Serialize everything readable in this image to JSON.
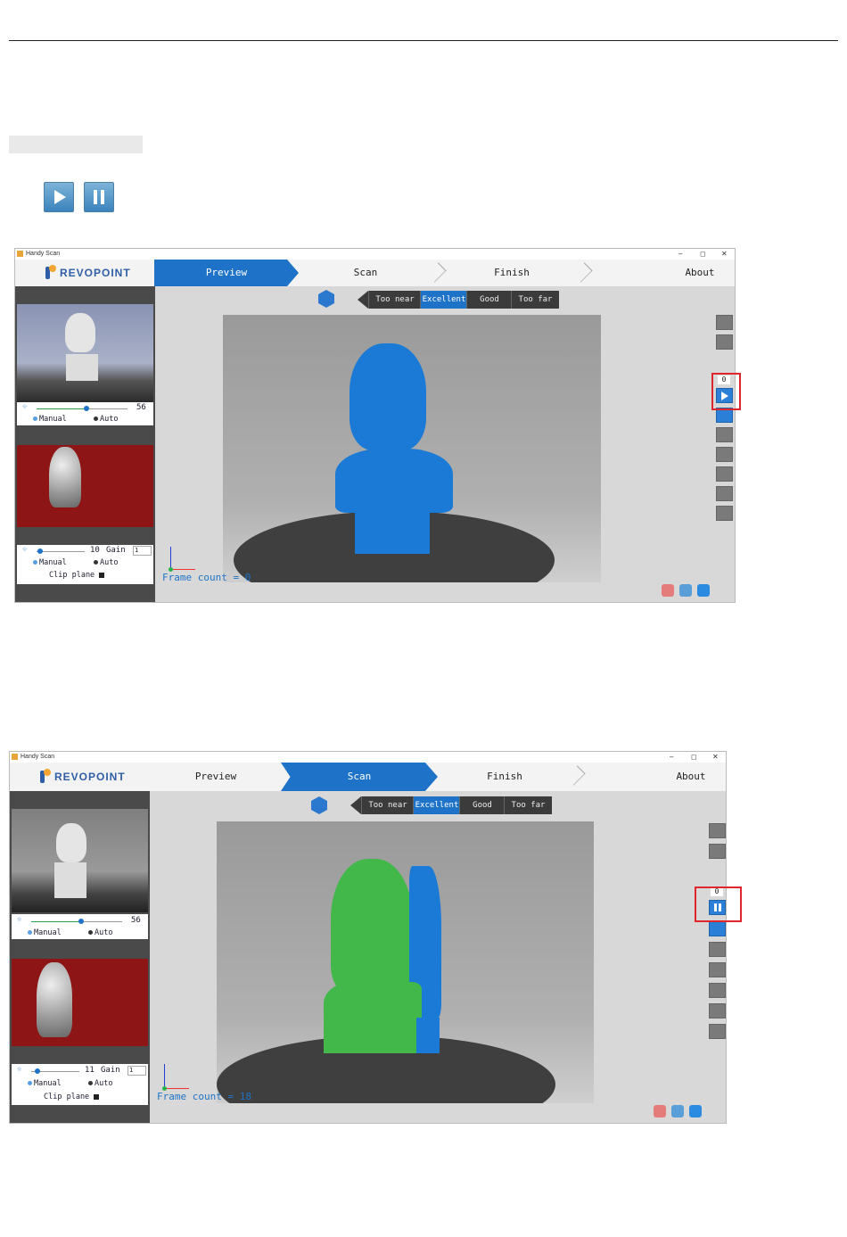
{
  "icons": {
    "play": "play-icon",
    "pause": "pause-icon"
  },
  "window1": {
    "title": "Handy Scan",
    "controls": [
      "–",
      "◻",
      "✕"
    ],
    "brand": "REVOPOINT",
    "tabs": [
      "Preview",
      "Scan",
      "Finish",
      "About"
    ],
    "active_tab": "Preview",
    "distance": [
      "Too near",
      "Excellent",
      "Good",
      "Too far"
    ],
    "distance_selected": "Excellent",
    "ir_value": "56",
    "ir_mode": {
      "manual": "Manual",
      "auto": "Auto"
    },
    "rgb_value": "10",
    "gain_label": "Gain",
    "gain_value": "1",
    "rgb_mode": {
      "manual": "Manual",
      "auto": "Auto"
    },
    "clip_plane": "Clip plane",
    "frame_count": "Frame count = 0",
    "counter": "0",
    "action": "play"
  },
  "window2": {
    "title": "Handy Scan",
    "controls": [
      "–",
      "◻",
      "✕"
    ],
    "brand": "REVOPOINT",
    "tabs": [
      "Preview",
      "Scan",
      "Finish",
      "About"
    ],
    "active_tab": "Scan",
    "distance": [
      "Too near",
      "Excellent",
      "Good",
      "Too far"
    ],
    "distance_selected": "Excellent",
    "ir_value": "56",
    "ir_mode": {
      "manual": "Manual",
      "auto": "Auto"
    },
    "rgb_value": "11",
    "gain_label": "Gain",
    "gain_value": "1",
    "rgb_mode": {
      "manual": "Manual",
      "auto": "Auto"
    },
    "clip_plane": "Clip plane",
    "frame_count": "Frame count = 18",
    "counter": "0",
    "action": "pause"
  },
  "colors": {
    "accent": "#1e73c8",
    "highlight": "#e0262a",
    "scan_blue": "#1a7ad6",
    "scan_green": "#43b84a"
  }
}
